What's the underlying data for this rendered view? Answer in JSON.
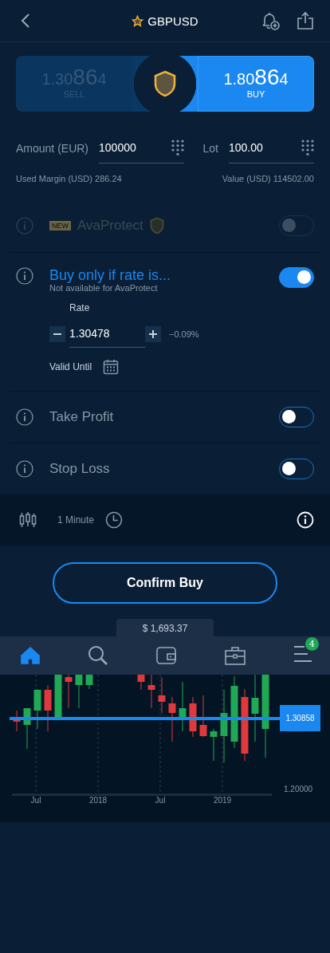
{
  "header": {
    "title": "GBPUSD",
    "favorite": true
  },
  "prices": [
    {
      "kind": "sell",
      "prefix": "1.30",
      "big": "86",
      "suffix": "4",
      "label": "SELL",
      "selected": false
    },
    {
      "kind": "buy",
      "prefix": "1.80",
      "big": "86",
      "suffix": "4",
      "label": "BUY",
      "selected": true
    }
  ],
  "amount": {
    "label": "Amount (EUR)",
    "value": "100000"
  },
  "lot": {
    "label": "Lot",
    "value": "100.00"
  },
  "used_margin": "Used Margin (USD) 286.24",
  "value_usd": "Value (USD) 114502.00",
  "options": [
    {
      "kind": "protect",
      "badge": "NEW",
      "label": "AvaProtect",
      "on": false,
      "disabled": true
    },
    {
      "kind": "limit",
      "label": "Buy only if rate is...",
      "sublabel": "Not available for AvaProtect",
      "on": true,
      "disabled": false,
      "rate_label": "Rate",
      "rate": "1.30478",
      "change": "−0.09%",
      "valid_label": "Valid Until"
    },
    {
      "kind": "plain",
      "label": "Take Profit",
      "on": false,
      "disabled": false
    },
    {
      "kind": "plain",
      "label": "Stop Loss",
      "on": false,
      "disabled": false
    }
  ],
  "chart_bar": {
    "interval": "1 Minute"
  },
  "confirm_button": "Confirm Buy",
  "balance": "$ 1,693.37",
  "nav": [
    {
      "kind": "home",
      "selected": true
    },
    {
      "kind": "search",
      "selected": false
    },
    {
      "kind": "wallet",
      "selected": false
    },
    {
      "kind": "portfolio",
      "selected": false
    },
    {
      "kind": "menu",
      "selected": false,
      "badge": "4"
    }
  ],
  "chart": {
    "x_labels": [
      "Jul",
      "2018",
      "Jul",
      "2019"
    ],
    "y_label": "1.20000",
    "price_tag": "1.30858"
  }
}
